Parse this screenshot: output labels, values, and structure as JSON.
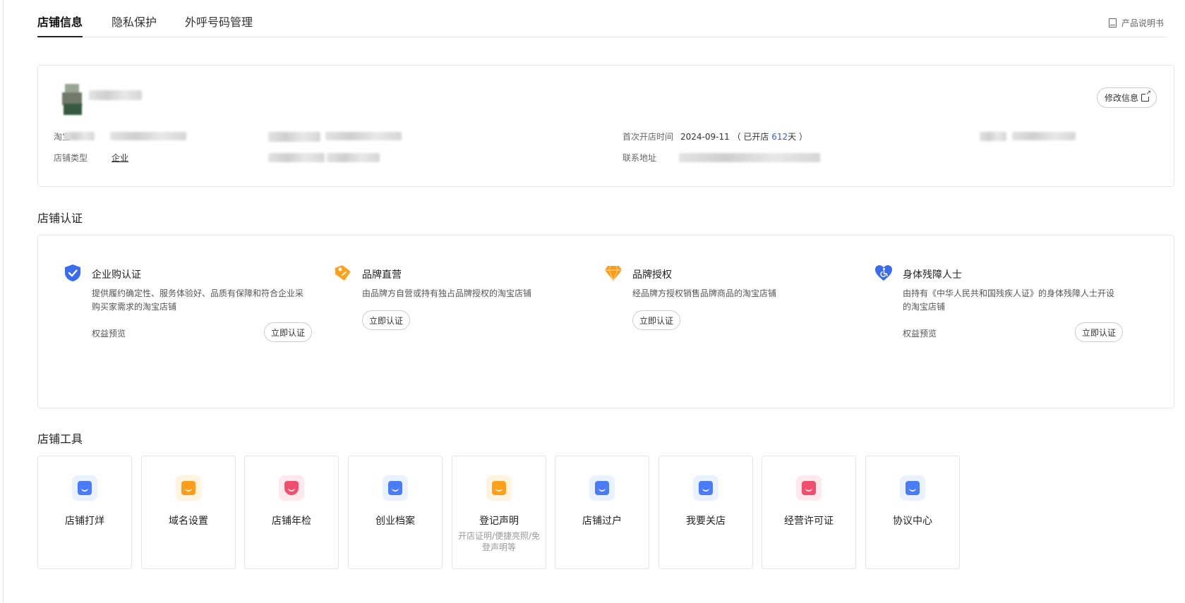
{
  "tabs": [
    {
      "label": "店铺信息",
      "active": true
    },
    {
      "label": "隐私保护",
      "active": false
    },
    {
      "label": "外呼号码管理",
      "active": false
    }
  ],
  "manual": {
    "label": "产品说明书",
    "icon": "book-icon"
  },
  "store_info": {
    "edit_label": "修改信息",
    "taobao_label_partial": "淘宝",
    "store_type_label": "店铺类型",
    "store_type_value": "企业",
    "open_time_label": "首次开店时间",
    "open_date": "2024-09-11",
    "open_prefix": "（ 已开店 ",
    "open_days": "612",
    "open_suffix": "天 ）",
    "address_label": "联系地址"
  },
  "cert_section": {
    "title": "店铺认证",
    "items": [
      {
        "title": "企业购认证",
        "desc": "提供履约确定性、服务体验好、品质有保障和符合企业采购买家需求的淘宝店铺",
        "benefit": "权益预览",
        "button": "立即认证",
        "icon": "shield-check-icon",
        "color": "#3a6cf0"
      },
      {
        "title": "品牌直营",
        "desc": "由品牌方自营或持有独占品牌授权的淘宝店铺",
        "benefit": "",
        "button": "立即认证",
        "icon": "tag-icon",
        "color": "#ffa11a"
      },
      {
        "title": "品牌授权",
        "desc": "经品牌方授权销售品牌商品的淘宝店铺",
        "benefit": "",
        "button": "立即认证",
        "icon": "diamond-icon",
        "color": "#ff9a16"
      },
      {
        "title": "身体残障人士",
        "desc": "由持有《中华人民共和国残疾人证》的身体残障人士开设的淘宝店铺",
        "benefit": "权益预览",
        "button": "立即认证",
        "icon": "heart-accessibility-icon",
        "color": "#3a6cf0"
      }
    ]
  },
  "tools_section": {
    "title": "店铺工具",
    "items": [
      {
        "name": "店铺打烊",
        "sub": "",
        "icon": "store-close-icon",
        "color": "#4a7cf7",
        "bg": "#eaf1ff"
      },
      {
        "name": "域名设置",
        "sub": "",
        "icon": "domain-settings-icon",
        "color": "#ff9c1a",
        "bg": "#fff3e2"
      },
      {
        "name": "店铺年检",
        "sub": "",
        "icon": "annual-check-icon",
        "color": "#f0506e",
        "bg": "#ffe9ed"
      },
      {
        "name": "创业档案",
        "sub": "",
        "icon": "archive-icon",
        "color": "#4a7cf7",
        "bg": "#eaf1ff"
      },
      {
        "name": "登记声明",
        "sub": "开店证明/便捷亮照/免登声明等",
        "icon": "registration-icon",
        "color": "#ffa11a",
        "bg": "#fff3e2"
      },
      {
        "name": "店铺过户",
        "sub": "",
        "icon": "transfer-icon",
        "color": "#4a7cf7",
        "bg": "#eaf1ff"
      },
      {
        "name": "我要关店",
        "sub": "",
        "icon": "close-store-icon",
        "color": "#4a7cf7",
        "bg": "#eaf1ff"
      },
      {
        "name": "经营许可证",
        "sub": "",
        "icon": "license-icon",
        "color": "#f0506e",
        "bg": "#ffe9ed"
      },
      {
        "name": "协议中心",
        "sub": "",
        "icon": "agreement-icon",
        "color": "#4a7cf7",
        "bg": "#eaf1ff"
      }
    ]
  }
}
